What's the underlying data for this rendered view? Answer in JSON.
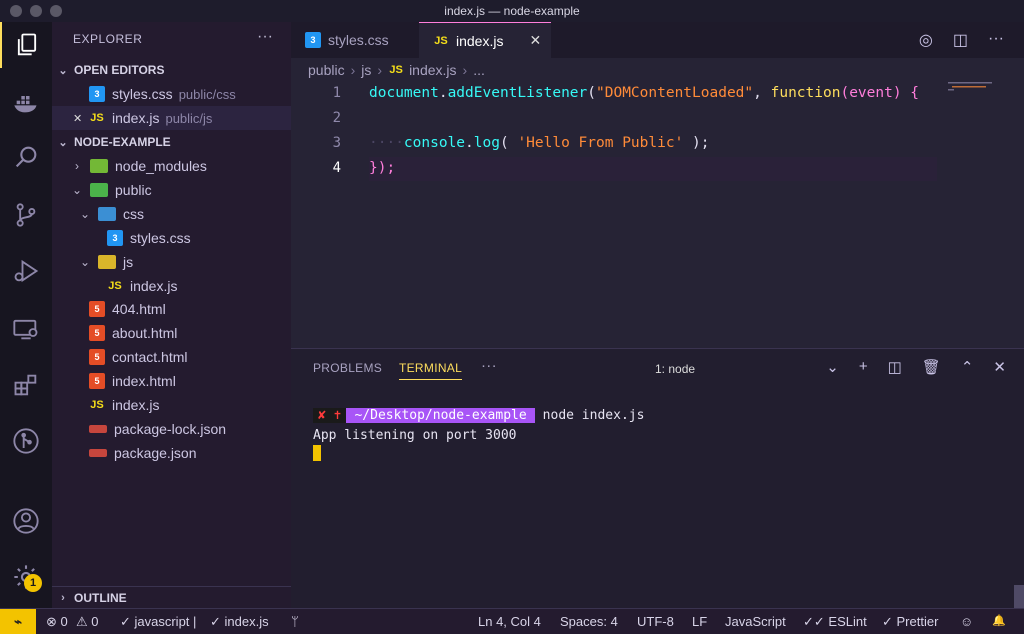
{
  "window": {
    "title": "index.js — node-example"
  },
  "activity_bar": {
    "items": [
      "explorer-icon",
      "docker-icon",
      "search-icon",
      "source-control-icon",
      "run-debug-icon",
      "remote-explorer-icon",
      "extensions-icon",
      "git-graph-icon",
      "account-icon",
      "settings-gear-icon"
    ],
    "settings_badge": "1",
    "accent": "#fede5d"
  },
  "sidebar": {
    "title": "EXPLORER",
    "more": "···",
    "open_editors": {
      "title": "OPEN EDITORS",
      "items": [
        {
          "name": "styles.css",
          "desc": "public/css"
        },
        {
          "close": "✕",
          "name": "index.js",
          "desc": "public/js"
        }
      ]
    },
    "project": {
      "title": "NODE-EXAMPLE",
      "tree": [
        {
          "label": "node_modules"
        },
        {
          "label": "public"
        },
        {
          "label": "css"
        },
        {
          "label": "styles.css"
        },
        {
          "label": "js"
        },
        {
          "label": "index.js"
        },
        {
          "label": "404.html"
        },
        {
          "label": "about.html"
        },
        {
          "label": "contact.html"
        },
        {
          "label": "index.html"
        },
        {
          "label": "index.js"
        },
        {
          "label": "package-lock.json"
        },
        {
          "label": "package.json"
        }
      ]
    },
    "outline": {
      "title": "OUTLINE"
    }
  },
  "editor": {
    "tabs": [
      {
        "icon": "3",
        "label": "styles.css"
      },
      {
        "icon": "JS",
        "label": "index.js",
        "close": "✕"
      }
    ],
    "breadcrumb": [
      "public",
      "js",
      "index.js",
      "..."
    ],
    "breadcrumb_icon": "JS",
    "line_numbers": [
      "1",
      "2",
      "3",
      "4"
    ],
    "code": {
      "l1_a": "document",
      "l1_b": ".",
      "l1_c": "addEventListener",
      "l1_d": "(",
      "l1_e": "\"DOMContentLoaded\"",
      "l1_f": ", ",
      "l1_g": "function",
      "l1_h": "(",
      "l1_i": "event",
      "l1_j": ") {",
      "l3_ws": "····",
      "l3_a": "console",
      "l3_b": ".",
      "l3_c": "log",
      "l3_d": "( ",
      "l3_e": "'Hello From Public'",
      "l3_f": " );",
      "l4": "});"
    }
  },
  "panel": {
    "tabs": [
      "PROBLEMS",
      "TERMINAL",
      "···"
    ],
    "active_tab": "TERMINAL",
    "terminal_select": "1: node",
    "terminal": {
      "prompt_status": "✘ ✝",
      "prompt_path": "~/Desktop/node-example",
      "command": "node index.js",
      "output": "App listening on port 3000"
    }
  },
  "status_bar": {
    "remote": "⌁",
    "errors": "⊗ 0",
    "warnings": "⚠ 0",
    "check_js": "✓ javascript |",
    "check_file": "✓ index.js",
    "git": "ᛘ",
    "position": "Ln 4, Col 4",
    "spaces": "Spaces: 4",
    "encoding": "UTF-8",
    "eol": "LF",
    "language": "JavaScript",
    "eslint": "✓✓ ESLint",
    "prettier": "✓ Prettier",
    "feedback": "☺",
    "bell": "🔔"
  }
}
